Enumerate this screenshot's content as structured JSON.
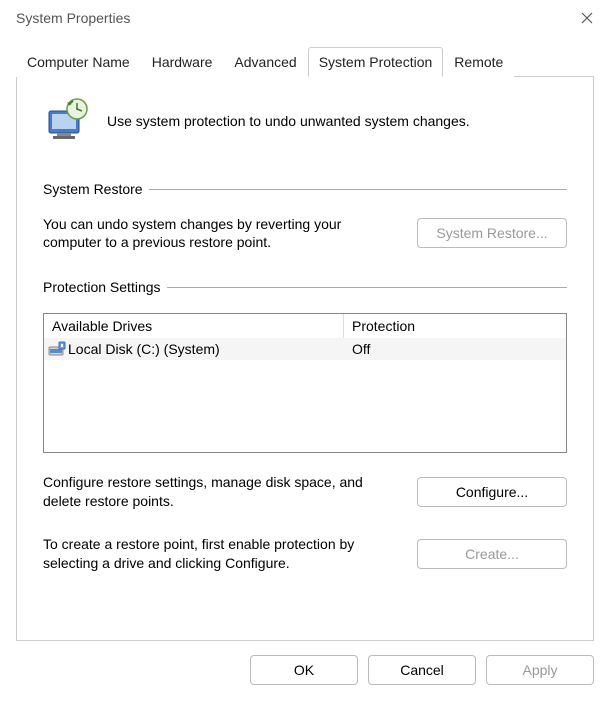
{
  "window": {
    "title": "System Properties"
  },
  "tabs": {
    "computer_name": "Computer Name",
    "hardware": "Hardware",
    "advanced": "Advanced",
    "system_protection": "System Protection",
    "remote": "Remote"
  },
  "hero_text": "Use system protection to undo unwanted system changes.",
  "system_restore": {
    "group_label": "System Restore",
    "desc": "You can undo system changes by reverting your computer to a previous restore point.",
    "button": "System Restore..."
  },
  "protection_settings": {
    "group_label": "Protection Settings",
    "header_drives": "Available Drives",
    "header_protection": "Protection",
    "rows": [
      {
        "name": "Local Disk (C:) (System)",
        "protection": "Off"
      }
    ],
    "configure_desc": "Configure restore settings, manage disk space, and delete restore points.",
    "configure_button": "Configure...",
    "create_desc": "To create a restore point, first enable protection by selecting a drive and clicking Configure.",
    "create_button": "Create..."
  },
  "footer": {
    "ok": "OK",
    "cancel": "Cancel",
    "apply": "Apply"
  }
}
